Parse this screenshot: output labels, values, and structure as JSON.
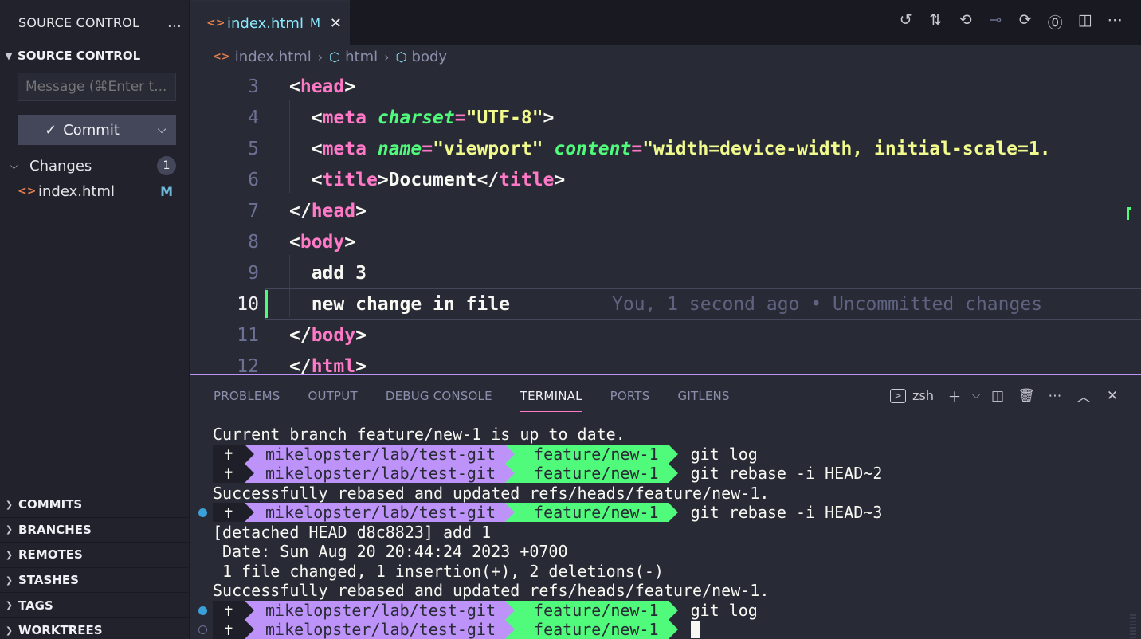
{
  "sidebar": {
    "header_title": "SOURCE CONTROL",
    "more_icon": "…",
    "section_title": "SOURCE CONTROL",
    "message_placeholder": "Message (⌘Enter t...",
    "commit_label": "Commit",
    "changes_label": "Changes",
    "changes_count": "1",
    "files": [
      {
        "name": "index.html",
        "status": "M"
      }
    ],
    "bottom_sections": [
      "COMMITS",
      "BRANCHES",
      "REMOTES",
      "STASHES",
      "TAGS",
      "WORKTREES"
    ]
  },
  "tab": {
    "name": "index.html",
    "modified": "M"
  },
  "breadcrumb": {
    "file": "index.html",
    "items": [
      "html",
      "body"
    ]
  },
  "editor": {
    "line_numbers": [
      "3",
      "4",
      "5",
      "6",
      "7",
      "8",
      "9",
      "10",
      "11",
      "12"
    ],
    "active_line": "10",
    "blame": "You, 1 second ago • Uncommitted changes",
    "line9_text": "add 3",
    "line10_text": "new change in file",
    "title_text": "Document",
    "charset_value": "\"UTF-8\"",
    "viewport_value": "\"viewport\"",
    "content_value": "\"width=device-width, initial-scale=1."
  },
  "panel": {
    "tabs": [
      "PROBLEMS",
      "OUTPUT",
      "DEBUG CONSOLE",
      "TERMINAL",
      "PORTS",
      "GITLENS"
    ],
    "active_tab": "TERMINAL",
    "shell": "zsh"
  },
  "terminal": {
    "prompt_path": "mikelopster/lab/test-git",
    "prompt_branch": " feature/new-1",
    "prompt_symbol": "✝",
    "lines": [
      {
        "kind": "text",
        "text": "Current branch feature/new-1 is up to date."
      },
      {
        "kind": "prompt",
        "cmd": "git log",
        "dot": ""
      },
      {
        "kind": "prompt",
        "cmd": "git rebase -i HEAD~2",
        "dot": ""
      },
      {
        "kind": "text",
        "text": "Successfully rebased and updated refs/heads/feature/new-1."
      },
      {
        "kind": "prompt",
        "cmd": "git rebase -i HEAD~3",
        "dot": "blue"
      },
      {
        "kind": "text",
        "text": "[detached HEAD d8c8823] add 1"
      },
      {
        "kind": "text",
        "text": " Date: Sun Aug 20 20:44:24 2023 +0700"
      },
      {
        "kind": "text",
        "text": " 1 file changed, 1 insertion(+), 2 deletions(-)"
      },
      {
        "kind": "text",
        "text": "Successfully rebased and updated refs/heads/feature/new-1."
      },
      {
        "kind": "prompt",
        "cmd": "git log",
        "dot": "blue"
      },
      {
        "kind": "prompt",
        "cmd": "",
        "dot": "hollow",
        "cursor": true
      }
    ]
  },
  "colors": {
    "accent": "#bd93f9",
    "tag": "#ff79c6",
    "attr": "#50fa7b",
    "string": "#f1fa8c",
    "branch_bg": "#50fa7b",
    "path_bg": "#bd93f9"
  }
}
